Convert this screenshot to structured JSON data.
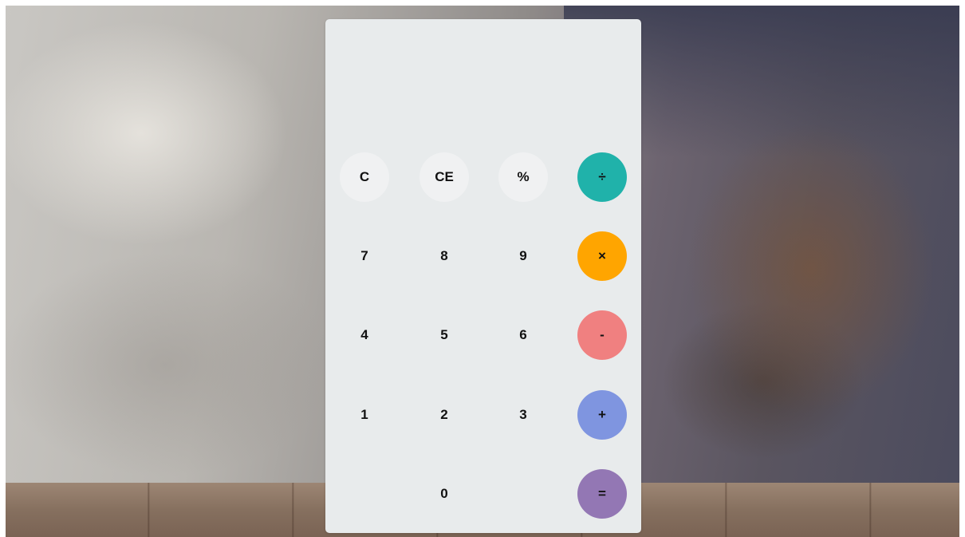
{
  "display": {
    "value": ""
  },
  "keys": {
    "clear": "C",
    "clear_entry": "CE",
    "percent": "%",
    "divide": "÷",
    "seven": "7",
    "eight": "8",
    "nine": "9",
    "multiply": "×",
    "four": "4",
    "five": "5",
    "six": "6",
    "subtract": "-",
    "one": "1",
    "two": "2",
    "three": "3",
    "add": "+",
    "zero": "0",
    "equals": "="
  },
  "colors": {
    "divide": "#20b2aa",
    "multiply": "#ffa500",
    "subtract": "#f08080",
    "add": "#7f95e0",
    "equals": "#9377b4",
    "panel": "#e8ebec"
  }
}
